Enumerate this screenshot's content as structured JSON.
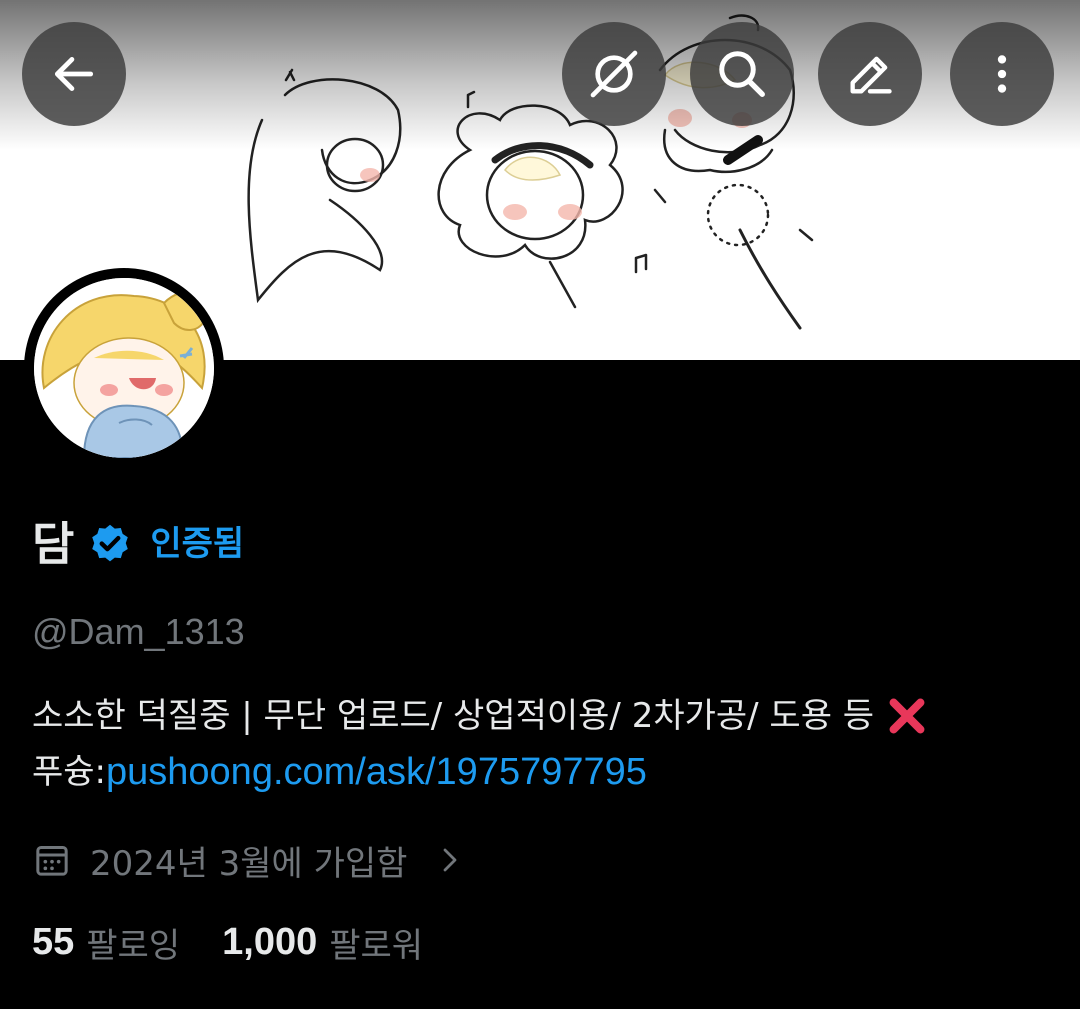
{
  "header": {
    "back_icon": "arrow-left-icon",
    "actions": [
      {
        "name": "no-eye-icon"
      },
      {
        "name": "search-icon"
      },
      {
        "name": "edit-pencil-icon"
      },
      {
        "name": "more-vertical-icon"
      }
    ]
  },
  "profile": {
    "display_name": "담",
    "verified_label": "인증됨",
    "handle": "@Dam_1313",
    "bio_line1": "소소한 덕질중 | 무단 업로드/ 상업적이용/ 2차가공/ 도용 등",
    "bio_line2_prefix": "푸슝:",
    "bio_link": "pushoong.com/ask/1975797795",
    "joined": "2024년 3월에 가입함",
    "following_count": "55",
    "following_label": "팔로잉",
    "followers_count": "1,000",
    "followers_label": "팔로워"
  },
  "colors": {
    "accent": "#1d9bf0",
    "text_primary": "#e7e9ea",
    "text_secondary": "#71767b",
    "background": "#000000"
  }
}
